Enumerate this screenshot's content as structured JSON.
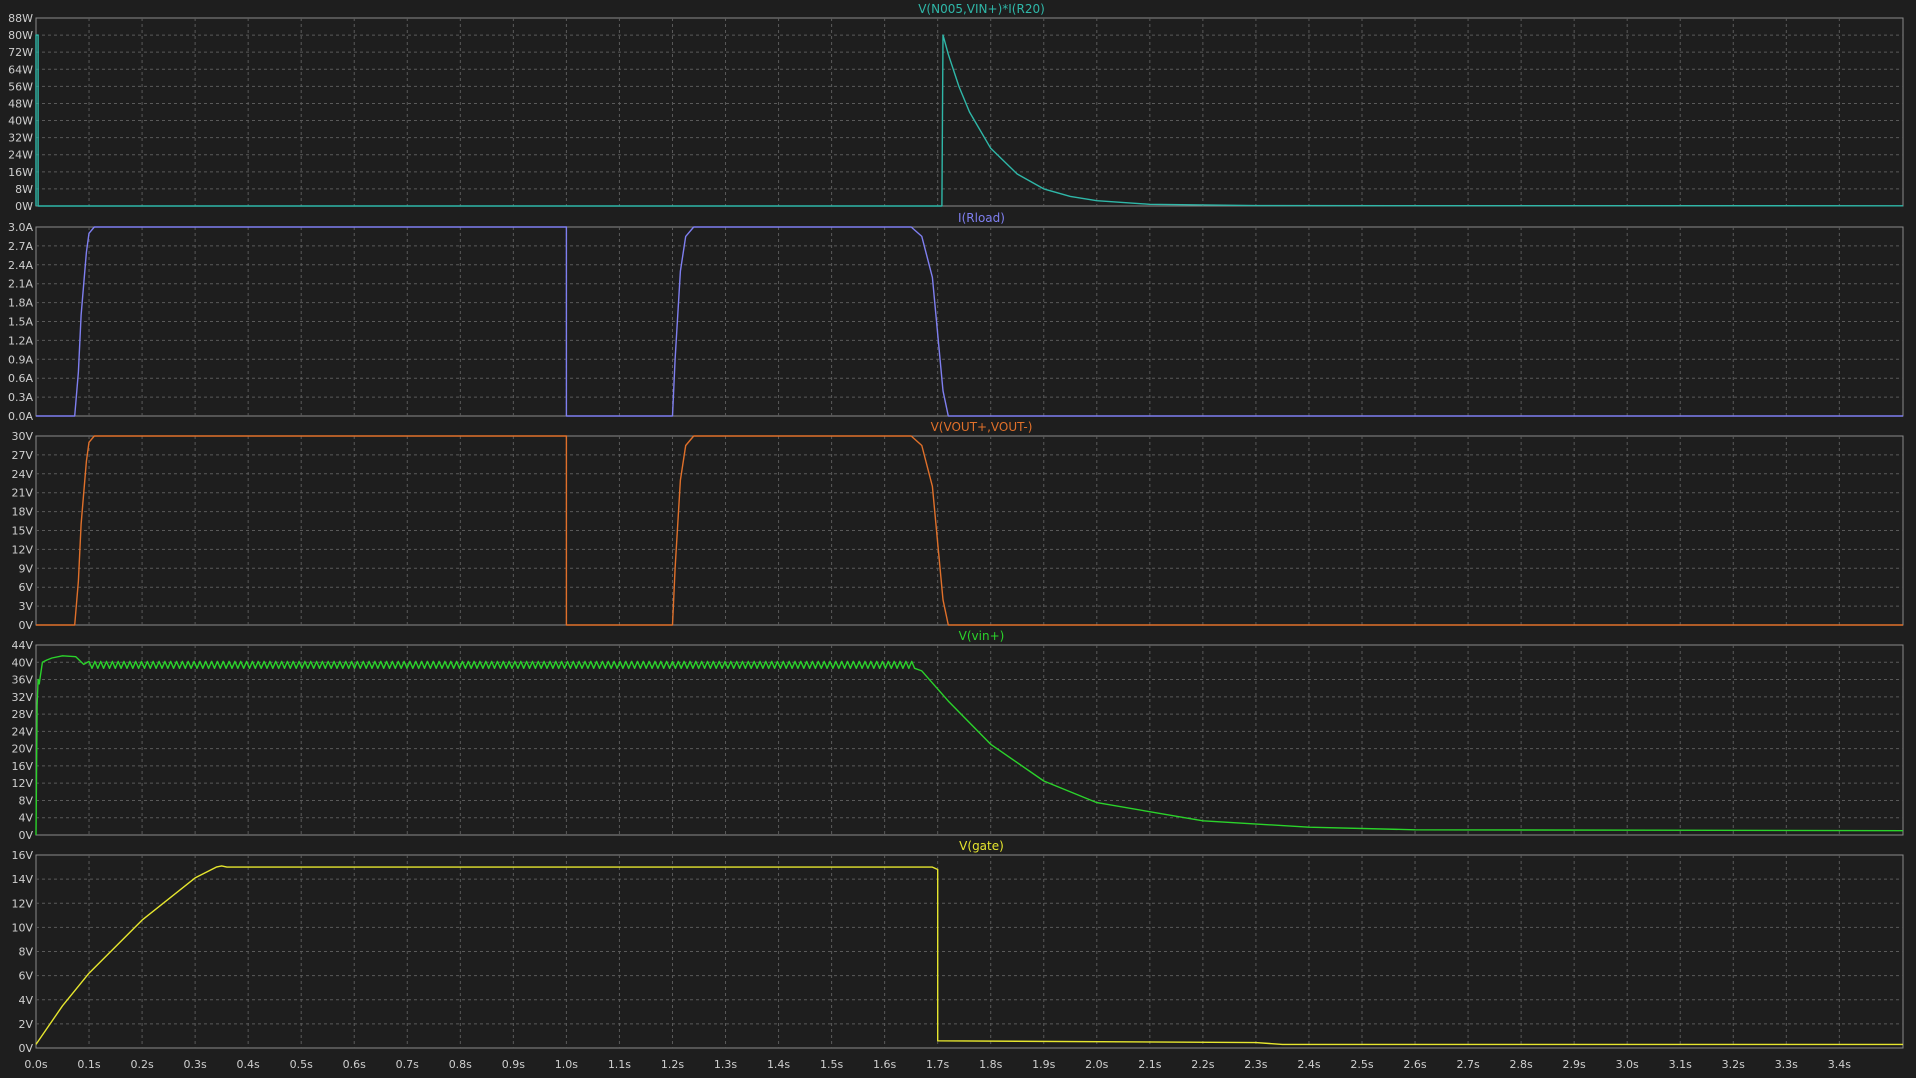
{
  "chart_data": {
    "type": "line",
    "background": "#1e1e1e",
    "grid": true,
    "xaxis": {
      "ticks": [
        "0.0s",
        "0.1s",
        "0.2s",
        "0.3s",
        "0.4s",
        "0.5s",
        "0.6s",
        "0.7s",
        "0.8s",
        "0.9s",
        "1.0s",
        "1.1s",
        "1.2s",
        "1.3s",
        "1.4s",
        "1.5s",
        "1.6s",
        "1.7s",
        "1.8s",
        "1.9s",
        "2.0s",
        "2.1s",
        "2.2s",
        "2.3s",
        "2.4s",
        "2.5s",
        "2.6s",
        "2.7s",
        "2.8s",
        "2.9s",
        "3.0s",
        "3.1s",
        "3.2s",
        "3.3s",
        "3.4s"
      ],
      "xlim": [
        0,
        3.52
      ]
    },
    "panes": [
      {
        "title": "V(N005,VIN+)*I(R20)",
        "color": "#2fb7a8",
        "ylim": [
          0,
          88
        ],
        "yticks": [
          "0W",
          "8W",
          "16W",
          "24W",
          "32W",
          "40W",
          "48W",
          "56W",
          "64W",
          "72W",
          "80W",
          "88W"
        ],
        "x": [
          0,
          0,
          0.004,
          0.004,
          1.708,
          1.71,
          1.72,
          1.74,
          1.76,
          1.8,
          1.85,
          1.9,
          1.95,
          2.0,
          2.1,
          2.3,
          3.52
        ],
        "y": [
          0,
          80,
          80,
          0,
          0,
          80,
          71,
          56,
          44,
          27,
          15,
          8,
          4.5,
          2.5,
          0.8,
          0.2,
          0.1
        ]
      },
      {
        "title": "I(Rload)",
        "color": "#7f7ff0",
        "ylim": [
          0,
          3.0
        ],
        "yticks": [
          "0.0A",
          "0.3A",
          "0.6A",
          "0.9A",
          "1.2A",
          "1.5A",
          "1.8A",
          "2.1A",
          "2.4A",
          "2.7A",
          "3.0A"
        ],
        "x": [
          0,
          0.073,
          0.08,
          0.085,
          0.095,
          0.1,
          0.11,
          1.0,
          1.0,
          1.2,
          1.205,
          1.215,
          1.225,
          1.24,
          1.65,
          1.67,
          1.69,
          1.7,
          1.71,
          1.72,
          3.52
        ],
        "y": [
          0,
          0,
          0.7,
          1.6,
          2.6,
          2.9,
          3.0,
          3.0,
          0,
          0,
          0.9,
          2.3,
          2.85,
          3.0,
          3.0,
          2.85,
          2.2,
          1.3,
          0.4,
          0,
          0
        ]
      },
      {
        "title": "V(VOUT+,VOUT-)",
        "color": "#e0702a",
        "ylim": [
          0,
          30
        ],
        "yticks": [
          "0V",
          "3V",
          "6V",
          "9V",
          "12V",
          "15V",
          "18V",
          "21V",
          "24V",
          "27V",
          "30V"
        ],
        "x": [
          0,
          0.073,
          0.08,
          0.085,
          0.095,
          0.1,
          0.11,
          1.0,
          1.0,
          1.2,
          1.205,
          1.215,
          1.225,
          1.24,
          1.65,
          1.67,
          1.69,
          1.7,
          1.71,
          1.72,
          3.52
        ],
        "y": [
          0,
          0,
          7,
          16,
          26,
          29,
          30,
          30,
          0,
          0,
          9,
          23,
          28.5,
          30,
          30,
          28.5,
          22,
          13,
          4,
          0,
          0
        ]
      },
      {
        "title": "V(vin+)",
        "color": "#2bd32b",
        "ylim": [
          0,
          44
        ],
        "yticks": [
          "0V",
          "4V",
          "8V",
          "12V",
          "16V",
          "20V",
          "24V",
          "28V",
          "32V",
          "36V",
          "40V",
          "44V"
        ],
        "x": [
          0,
          0.002,
          0.004,
          0.006,
          0.012,
          0.02,
          0.03,
          0.05,
          0.075,
          0.09,
          1.65,
          1.67,
          1.72,
          1.8,
          1.9,
          2.0,
          2.2,
          2.4,
          2.6,
          3.52
        ],
        "y": [
          0,
          30,
          36,
          35,
          40,
          40.5,
          41,
          41.5,
          41.3,
          39.5,
          39.5,
          38,
          31,
          21,
          12.5,
          7.5,
          3.3,
          1.8,
          1.2,
          1.0
        ],
        "ripple": {
          "from": 0.1,
          "to": 1.66,
          "low": 38.6,
          "high": 40.2,
          "period": 0.011
        }
      },
      {
        "title": "V(gate)",
        "color": "#e6e62e",
        "ylim": [
          0,
          16
        ],
        "yticks": [
          "0V",
          "2V",
          "4V",
          "6V",
          "8V",
          "10V",
          "12V",
          "14V",
          "16V"
        ],
        "x": [
          0,
          0.05,
          0.1,
          0.2,
          0.3,
          0.34,
          0.35,
          0.36,
          1.69,
          1.7,
          1.7,
          2.3,
          2.35,
          3.52
        ],
        "y": [
          0.3,
          3.5,
          6.2,
          10.6,
          14.1,
          15.0,
          15.1,
          15.0,
          15.0,
          14.8,
          0.6,
          0.45,
          0.3,
          0.3
        ]
      }
    ]
  }
}
